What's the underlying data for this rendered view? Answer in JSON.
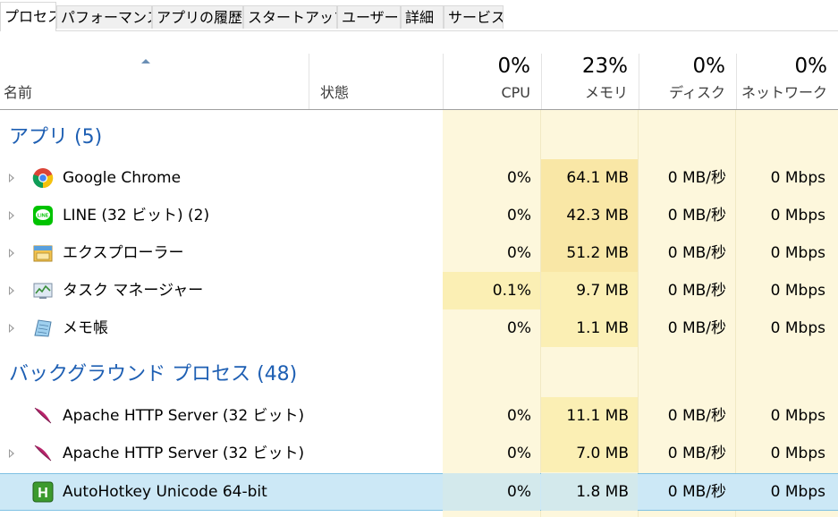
{
  "tabs": [
    {
      "label": "プロセス",
      "active": true
    },
    {
      "label": "パフォーマンス"
    },
    {
      "label": "アプリの履歴"
    },
    {
      "label": "スタートアップ"
    },
    {
      "label": "ユーザー"
    },
    {
      "label": "詳細"
    },
    {
      "label": "サービス"
    }
  ],
  "header": {
    "name": "名前",
    "status": "状態",
    "cpu": {
      "pct": "0%",
      "label": "CPU"
    },
    "memory": {
      "pct": "23%",
      "label": "メモリ"
    },
    "disk": {
      "pct": "0%",
      "label": "ディスク"
    },
    "network": {
      "pct": "0%",
      "label": "ネットワーク"
    }
  },
  "groups": {
    "apps": "アプリ (5)",
    "background": "バックグラウンド プロセス (48)"
  },
  "rows": [
    {
      "name": "Google Chrome",
      "cpu": "0%",
      "mem": "64.1 MB",
      "disk": "0 MB/秒",
      "net": "0 Mbps",
      "icon": "chrome-icon"
    },
    {
      "name": "LINE (32 ビット) (2)",
      "cpu": "0%",
      "mem": "42.3 MB",
      "disk": "0 MB/秒",
      "net": "0 Mbps",
      "icon": "line-icon",
      "icon_text": "LINE"
    },
    {
      "name": "エクスプローラー",
      "cpu": "0%",
      "mem": "51.2 MB",
      "disk": "0 MB/秒",
      "net": "0 Mbps",
      "icon": "explorer-icon"
    },
    {
      "name": "タスク マネージャー",
      "cpu": "0.1%",
      "mem": "9.7 MB",
      "disk": "0 MB/秒",
      "net": "0 Mbps",
      "icon": "task-manager-icon"
    },
    {
      "name": "メモ帳",
      "cpu": "0%",
      "mem": "1.1 MB",
      "disk": "0 MB/秒",
      "net": "0 Mbps",
      "icon": "notepad-icon"
    },
    {
      "name": "Apache HTTP Server (32 ビット)",
      "cpu": "0%",
      "mem": "11.1 MB",
      "disk": "0 MB/秒",
      "net": "0 Mbps",
      "icon": "apache-feather-icon"
    },
    {
      "name": "Apache HTTP Server (32 ビット)",
      "cpu": "0%",
      "mem": "7.0 MB",
      "disk": "0 MB/秒",
      "net": "0 Mbps",
      "icon": "apache-feather-icon"
    },
    {
      "name": "AutoHotkey Unicode 64-bit",
      "cpu": "0%",
      "mem": "1.8 MB",
      "disk": "0 MB/秒",
      "net": "0 Mbps",
      "icon": "autohotkey-icon",
      "icon_text": "H"
    }
  ]
}
